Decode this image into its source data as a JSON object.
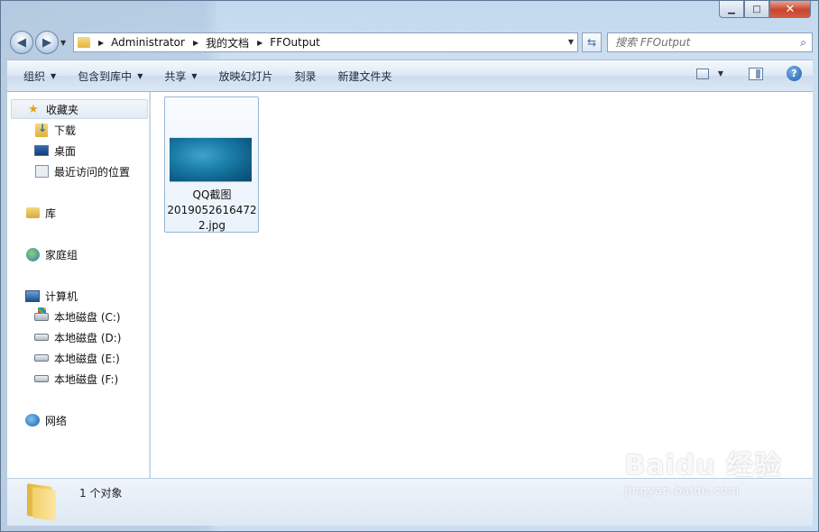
{
  "window": {
    "caption": {
      "minimize": "▁",
      "maximize": "□",
      "close": "✕"
    }
  },
  "address": {
    "crumbs": [
      "Administrator",
      "我的文档",
      "FFOutput"
    ]
  },
  "search": {
    "placeholder": "搜索 FFOutput"
  },
  "toolbar": {
    "items": [
      {
        "label": "组织",
        "has_arrow": true
      },
      {
        "label": "包含到库中",
        "has_arrow": true
      },
      {
        "label": "共享",
        "has_arrow": true
      },
      {
        "label": "放映幻灯片",
        "has_arrow": false
      },
      {
        "label": "刻录",
        "has_arrow": false
      },
      {
        "label": "新建文件夹",
        "has_arrow": false
      }
    ],
    "help_label": "?"
  },
  "nav": {
    "favorites": {
      "label": "收藏夹",
      "icon": "star-icon"
    },
    "favorite_items": [
      {
        "label": "下载",
        "icon": "downloads-folder-icon"
      },
      {
        "label": "桌面",
        "icon": "desktop-icon"
      },
      {
        "label": "最近访问的位置",
        "icon": "recent-places-icon"
      }
    ],
    "libraries": {
      "label": "库",
      "icon": "library-icon"
    },
    "homegroup": {
      "label": "家庭组",
      "icon": "homegroup-icon"
    },
    "computer": {
      "label": "计算机",
      "icon": "computer-icon"
    },
    "drives": [
      {
        "label": "本地磁盘 (C:)",
        "icon": "system-drive-icon"
      },
      {
        "label": "本地磁盘 (D:)",
        "icon": "drive-icon"
      },
      {
        "label": "本地磁盘 (E:)",
        "icon": "drive-icon"
      },
      {
        "label": "本地磁盘 (F:)",
        "icon": "drive-icon"
      }
    ],
    "network": {
      "label": "网络",
      "icon": "network-icon"
    }
  },
  "files": [
    {
      "name_line1": "QQ截图",
      "name_line2": "2019052616472",
      "name_line3": "2.jpg"
    }
  ],
  "status": {
    "count_text": "1 个对象"
  },
  "watermark": {
    "main": "Baidu 经验",
    "sub": "jingyan.baidu.com"
  },
  "colors": {
    "accent": "#1f4e79",
    "toolbar_bg": "#dce7f4",
    "selection_border": "#9ab6d3"
  }
}
